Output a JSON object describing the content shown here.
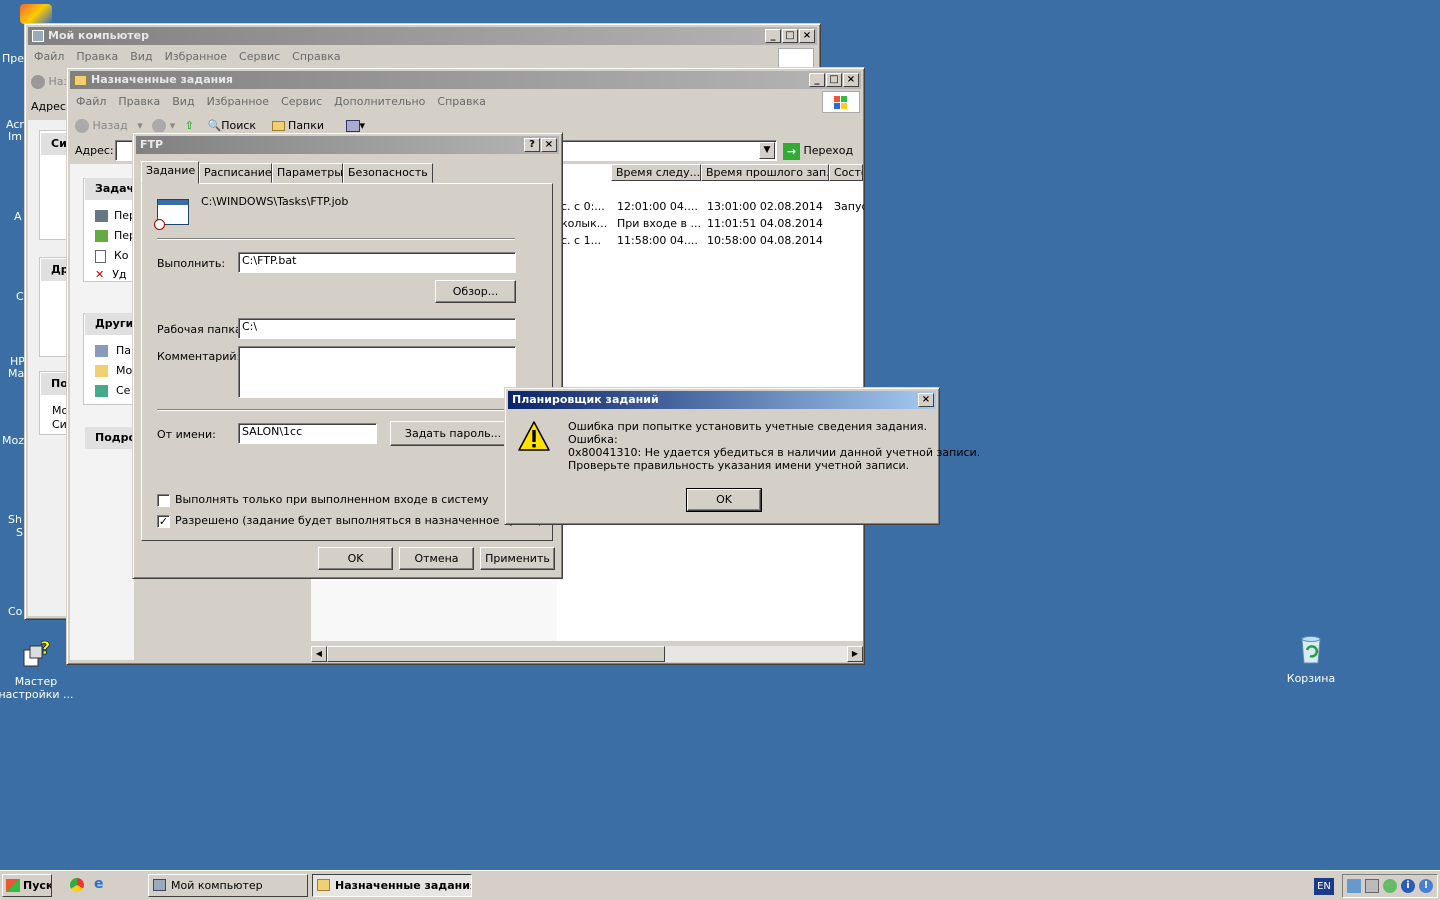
{
  "desktop": {
    "left_icon_fragments": [
      "Пре",
      "Acr",
      "Im",
      "A",
      "C",
      "HP",
      "Ma",
      "Moz",
      "Sh",
      "S",
      "Co"
    ],
    "wizard_icon_label": "Мастер настройки ...",
    "recycle_label": "Корзина"
  },
  "my_computer_window": {
    "title": "Мой компьютер",
    "menu": [
      "Файл",
      "Правка",
      "Вид",
      "Избранное",
      "Сервис",
      "Справка"
    ],
    "back_label": "Наз",
    "address_label": "Адрес:",
    "side_headers": [
      "Си",
      "Др",
      "По",
      "Подро"
    ],
    "side_fragments": [
      "Мо",
      "Сис"
    ]
  },
  "tasks_window": {
    "title": "Назначенные задания",
    "menu": [
      "Файл",
      "Правка",
      "Вид",
      "Избранное",
      "Сервис",
      "Дополнительно",
      "Справка"
    ],
    "toolbar": {
      "back": "Назад",
      "search": "Поиск",
      "folders": "Папки"
    },
    "address_label": "Адрес:",
    "go_label": "Переход",
    "side": {
      "tasks_header": "Задач",
      "tasks_items": [
        "Пер",
        "Пер",
        "Ко",
        "Уд"
      ],
      "other_header": "Други",
      "other_items": [
        "Па",
        "Мо",
        "Се"
      ],
      "details_header": "Подро"
    },
    "columns": [
      "Время следу...",
      "Время прошлого зап...",
      "Состо"
    ],
    "rows": [
      [
        "с. с 0:...",
        "12:01:00  04....",
        "13:01:00  02.08.2014",
        "Запус"
      ],
      [
        "колык...",
        "При входе в ...",
        "11:01:51  04.08.2014",
        ""
      ],
      [
        "с. с 1...",
        "11:58:00  04....",
        "10:58:00  04.08.2014",
        ""
      ]
    ]
  },
  "ftp_dialog": {
    "title": "FTP",
    "tabs": [
      "Задание",
      "Расписание",
      "Параметры",
      "Безопасность"
    ],
    "path": "C:\\WINDOWS\\Tasks\\FTP.job",
    "run_label": "Выполнить:",
    "run_value": "C:\\FTP.bat",
    "browse_label": "Обзор...",
    "workdir_label": "Рабочая папка:",
    "workdir_value": "C:\\",
    "comment_label": "Комментарий:",
    "comment_value": "",
    "runas_label": "От имени:",
    "runas_value": "SALON\\1cc",
    "set_password_label": "Задать пароль...",
    "check_logon_label": "Выполнять только при выполненном входе в систему",
    "check_logon_checked": false,
    "check_enabled_label": "Разрешено (задание будет выполняться в назначенное время)",
    "check_enabled_checked": true,
    "ok": "OK",
    "cancel": "Отмена",
    "apply": "Применить"
  },
  "error_dialog": {
    "title": "Планировщик заданий",
    "lines": [
      "Ошибка при попытке установить учетные сведения задания.",
      "Ошибка:",
      "0x80041310: Не удается убедиться в наличии данной учетной записи.",
      "Проверьте правильность указания имени учетной записи."
    ],
    "ok": "OK"
  },
  "taskbar": {
    "start": "Пуск",
    "tasks": [
      "Мой компьютер",
      "Назначенные задания"
    ],
    "lang": "EN"
  },
  "colors": {
    "desktop": "#3a6ea5",
    "active_title": "#0a246a",
    "inactive_title": "#808080"
  }
}
